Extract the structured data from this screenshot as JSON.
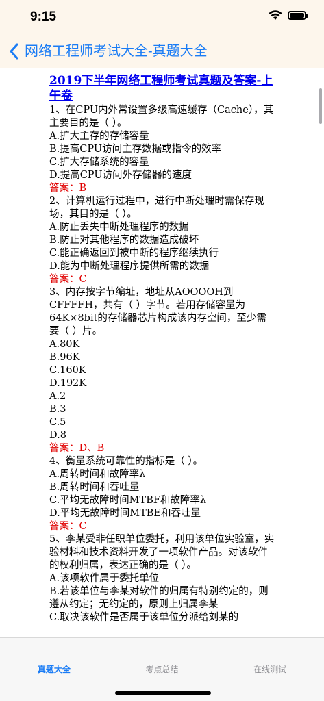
{
  "status_bar": {
    "time": "9:15"
  },
  "nav": {
    "title": "网络工程师考试大全-真题大全"
  },
  "article": {
    "title": "2019下半年网络工程师考试真题及答案-上午卷",
    "lines": [
      {
        "text": "1、在CPU内外常设置多级高速缓存（Cache），其主要目的是（ ）。",
        "kind": "text"
      },
      {
        "text": "A.扩大主存的存储容量",
        "kind": "text"
      },
      {
        "text": "B.提高CPU访问主存数据或指令的效率",
        "kind": "text"
      },
      {
        "text": "C.扩大存储系统的容量",
        "kind": "text"
      },
      {
        "text": "D.提高CPU访问外存储器的速度",
        "kind": "text"
      },
      {
        "text": "答案：B",
        "kind": "answer"
      },
      {
        "text": "2、计算机运行过程中，进行中断处理时需保存现场，其目的是（ ）。",
        "kind": "text"
      },
      {
        "text": "A.防止丢失中断处理程序的数据",
        "kind": "text"
      },
      {
        "text": "B.防止对其他程序的数据造成破坏",
        "kind": "text"
      },
      {
        "text": "C.能正确返回到被中断的程序继续执行",
        "kind": "text"
      },
      {
        "text": "D.能为中断处理程序提供所需的数据",
        "kind": "text"
      },
      {
        "text": "答案：C",
        "kind": "answer"
      },
      {
        "text": "3、内存按字节编址，地址从AOOOOH到CFFFFH，共有（ ）字节。若用存储容量为64K×8bit的存储器芯片构成该内存空间，至少需要（ ）片。",
        "kind": "text"
      },
      {
        "text": "A.80K",
        "kind": "text"
      },
      {
        "text": "B.96K",
        "kind": "text"
      },
      {
        "text": "C.160K",
        "kind": "text"
      },
      {
        "text": "D.192K",
        "kind": "text"
      },
      {
        "text": "A.2",
        "kind": "text"
      },
      {
        "text": "B.3",
        "kind": "text"
      },
      {
        "text": "C.5",
        "kind": "text"
      },
      {
        "text": "D.8",
        "kind": "text"
      },
      {
        "text": "答案：D、B",
        "kind": "answer"
      },
      {
        "text": "4、衡量系统可靠性的指标是（ ）。",
        "kind": "text"
      },
      {
        "text": "A.周转时间和故障率λ",
        "kind": "text"
      },
      {
        "text": "B.周转时间和吞吐量",
        "kind": "text"
      },
      {
        "text": "C.平均无故障时间MTBF和故障率λ",
        "kind": "text"
      },
      {
        "text": "D.平均无故障时间MTBE和吞吐量",
        "kind": "text"
      },
      {
        "text": "答案：C",
        "kind": "answer"
      },
      {
        "text": "5、李某受非任职单位委托，利用该单位实验室，实验材料和技术资料开发了一项软件产品。对该软件的权利归属，表达正确的是（ ）。",
        "kind": "text"
      },
      {
        "text": "A.该项软件属于委托单位",
        "kind": "text"
      },
      {
        "text": "B.若该单位与李某对软件的归属有特别约定的，则遵从约定；无约定的，原则上归属李某",
        "kind": "text"
      },
      {
        "text": "C.取决该软件是否属于该单位分派给刘某的",
        "kind": "text"
      }
    ]
  },
  "tabs": [
    {
      "label": "真题大全",
      "active": true
    },
    {
      "label": "考点总结",
      "active": false
    },
    {
      "label": "在线测试",
      "active": false
    }
  ]
}
